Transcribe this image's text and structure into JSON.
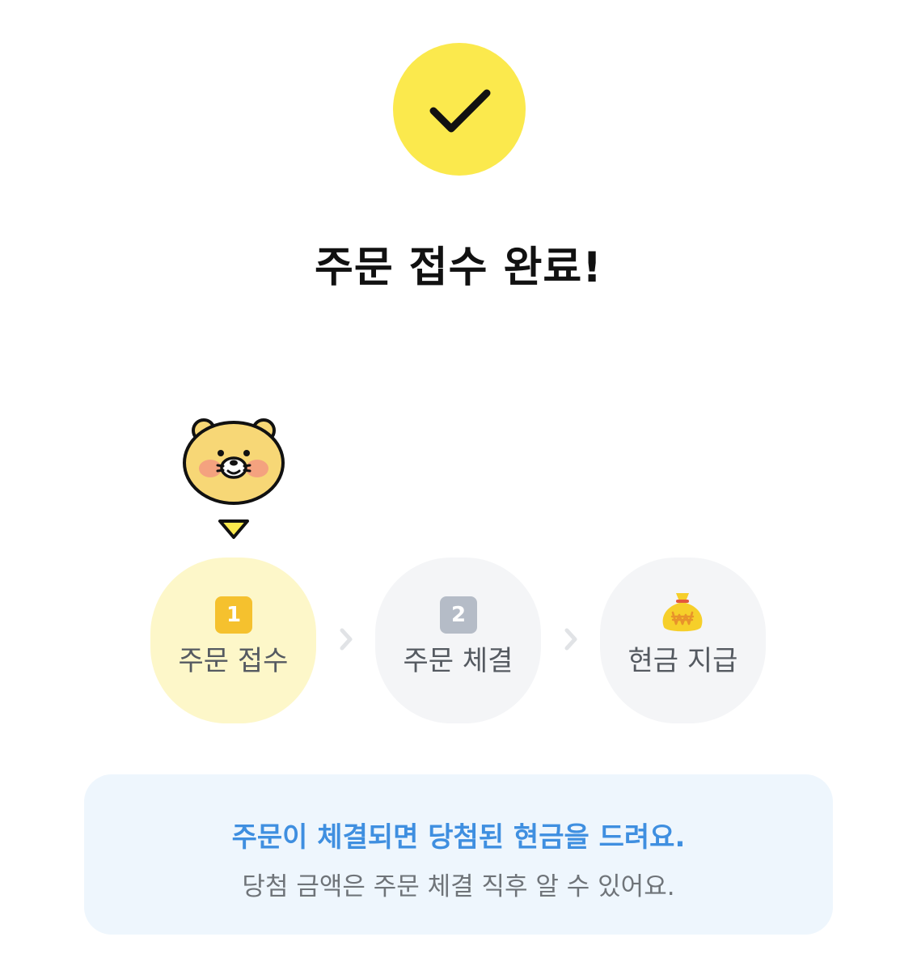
{
  "header": {
    "title": "주문 접수 완료!"
  },
  "steps": [
    {
      "number": "1",
      "label": "주문 접수",
      "state": "active"
    },
    {
      "number": "2",
      "label": "주문 체결",
      "state": "pending"
    },
    {
      "icon": "money-bag-icon",
      "label": "현금 지급",
      "state": "pending"
    }
  ],
  "info": {
    "main": "주문이 체결되면 당첨된 현금을 드려요.",
    "sub": "당첨 금액은 주문 체결 직후 알 수 있어요."
  },
  "colors": {
    "accent_yellow": "#fbe94d",
    "active_step_bg": "#fdf7c9",
    "info_text_blue": "#3f8fe0",
    "info_bg": "#eef6fd"
  }
}
